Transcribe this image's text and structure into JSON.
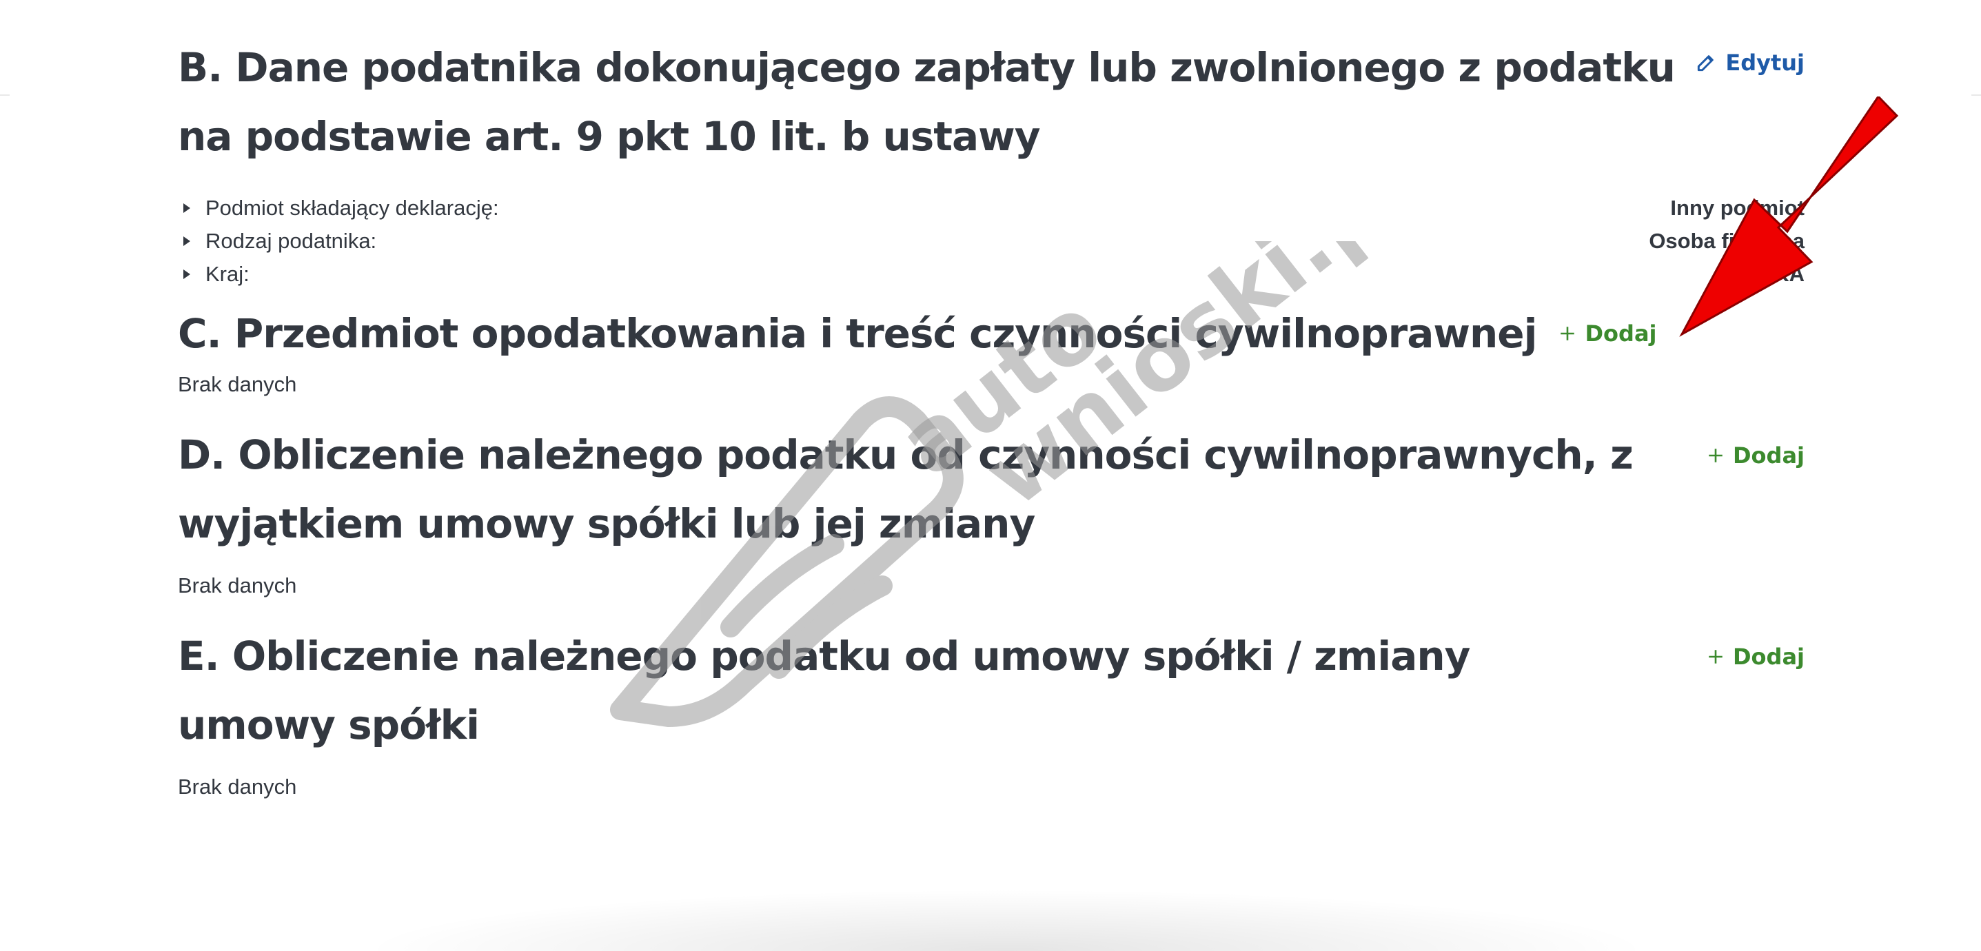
{
  "sections": {
    "b": {
      "title": "B. Dane podatnika dokonującego zapłaty lub zwolnionego z podatku na podstawie art. 9 pkt 10 lit. b ustawy",
      "action_label": "Edytuj",
      "fields": [
        {
          "label": "Podmiot składający deklarację:",
          "value": "Inny podmiot"
        },
        {
          "label": "Rodzaj podatnika:",
          "value": "Osoba fizyczna"
        },
        {
          "label": "Kraj:",
          "value": "POLSKA"
        }
      ]
    },
    "c": {
      "title": "C. Przedmiot opodatkowania i treść czynności cywilnoprawnej",
      "action_label": "Dodaj",
      "empty_text": "Brak danych"
    },
    "d": {
      "title": "D. Obliczenie należnego podatku od czynności cywilnoprawnych, z wyjątkiem umowy spółki lub jej zmiany",
      "action_label": "Dodaj",
      "empty_text": "Brak danych"
    },
    "e": {
      "title": "E. Obliczenie należnego podatku od umowy spółki / zmiany umowy spółki",
      "action_label": "Dodaj",
      "empty_text": "Brak danych"
    }
  },
  "watermark": {
    "line1": "auto",
    "line2": "wnioski.pl"
  },
  "icons": {
    "edit": "pencil-icon",
    "add": "plus-icon"
  },
  "colors": {
    "edit": "#1e5aa8",
    "add": "#3c8a2e",
    "text": "#333840",
    "arrow": "#ee0000",
    "watermark": "#c4c4c4"
  }
}
